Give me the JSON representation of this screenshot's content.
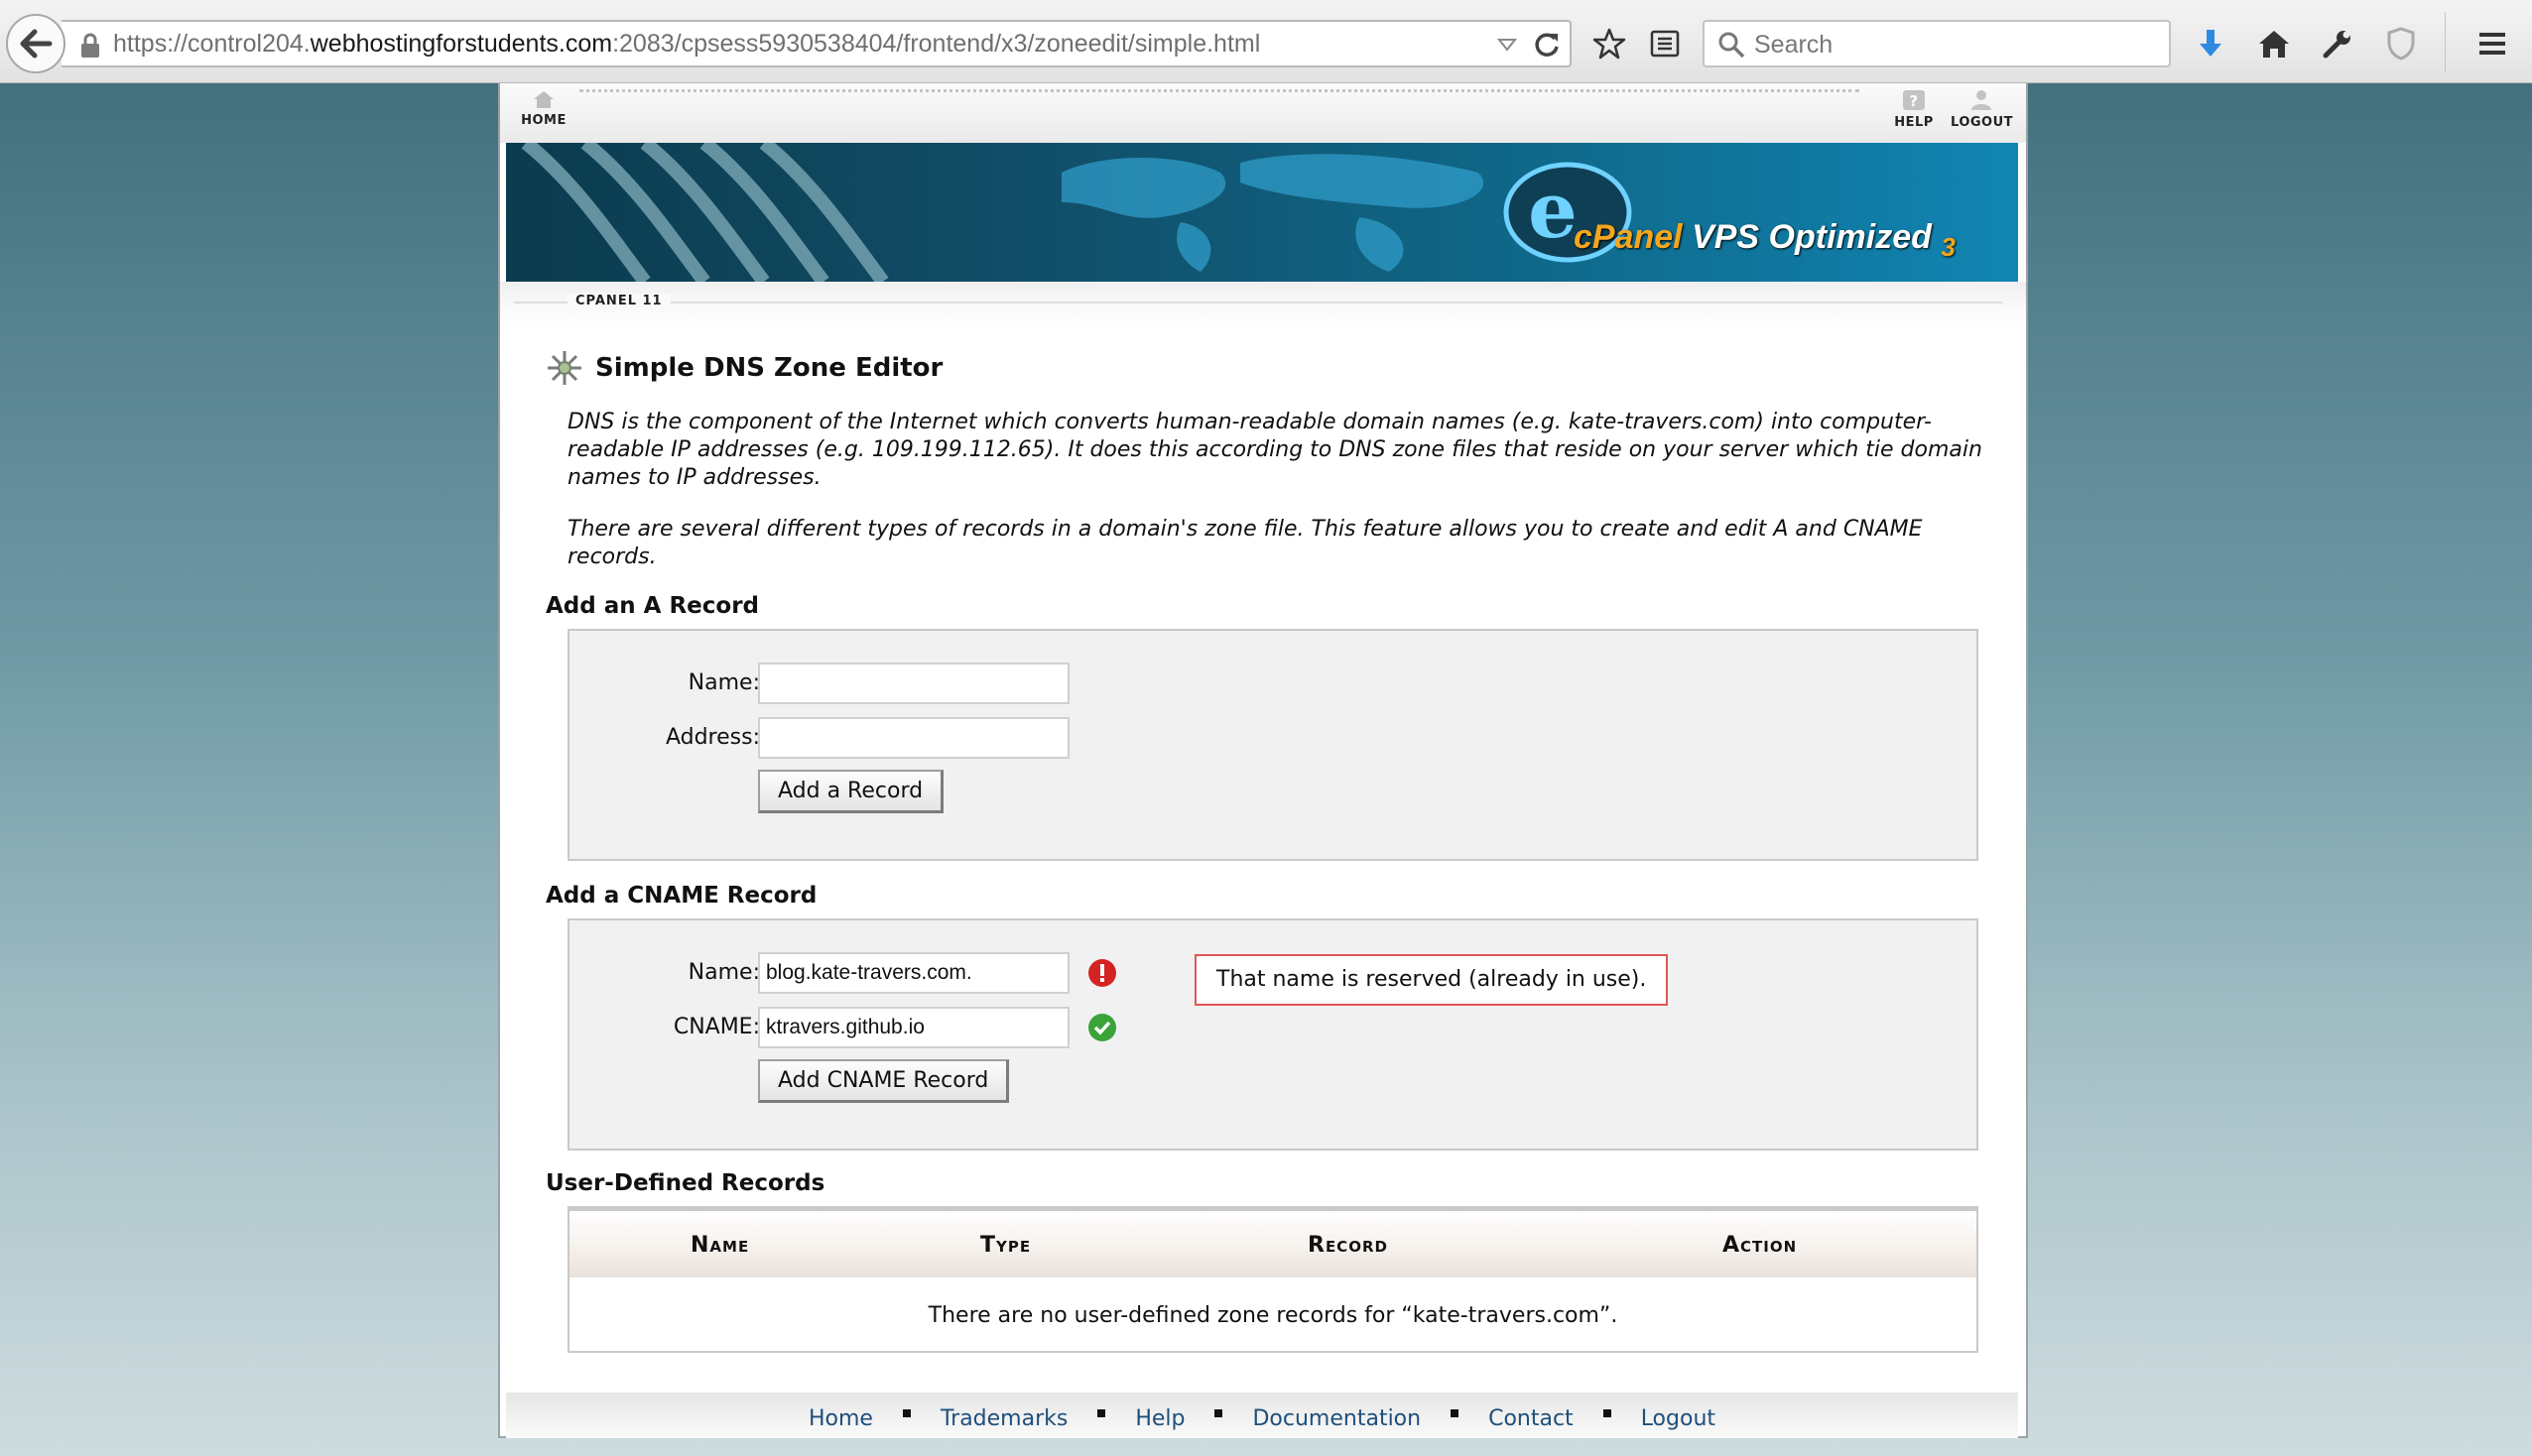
{
  "browser": {
    "url_prefix": "https://control204.",
    "url_domain": "webhostingforstudents.com",
    "url_suffix": ":2083/cpsess5930538404/frontend/x3/zoneedit/simple.html",
    "search_placeholder": "Search"
  },
  "nav": {
    "home": "HOME",
    "help": "HELP",
    "logout": "LOGOUT"
  },
  "banner": {
    "brand": "cPanel",
    "product": "VPS Optimized",
    "version_mark": "3"
  },
  "version_label": "CPANEL 11",
  "page": {
    "title": "Simple DNS Zone Editor",
    "desc1": "DNS is the component of the Internet which converts human-readable domain names (e.g. kate-travers.com) into computer-readable IP addresses (e.g. 109.199.112.65). It does this according to DNS zone files that reside on your server which tie domain names to IP addresses.",
    "desc2": "There are several different types of records in a domain's zone file. This feature allows you to create and edit A and CNAME records."
  },
  "a_record": {
    "title": "Add an A Record",
    "name_label": "Name:",
    "address_label": "Address:",
    "name_value": "",
    "address_value": "",
    "button": "Add a Record"
  },
  "cname_record": {
    "title": "Add a CNAME Record",
    "name_label": "Name:",
    "cname_label": "CNAME:",
    "name_value": "blog.kate-travers.com.",
    "cname_value": "ktravers.github.io",
    "error_message": "That name is reserved (already in use).",
    "button": "Add CNAME Record"
  },
  "user_records": {
    "title": "User-Defined Records",
    "columns": [
      "Name",
      "Type",
      "Record",
      "Action"
    ],
    "empty_message": "There are no user-defined zone records for “kate-travers.com”."
  },
  "footer": {
    "links": [
      "Home",
      "Trademarks",
      "Help",
      "Documentation",
      "Contact",
      "Logout"
    ]
  },
  "colors": {
    "error": "#d42323",
    "success": "#3aa33a",
    "link": "#1f4f7a"
  }
}
